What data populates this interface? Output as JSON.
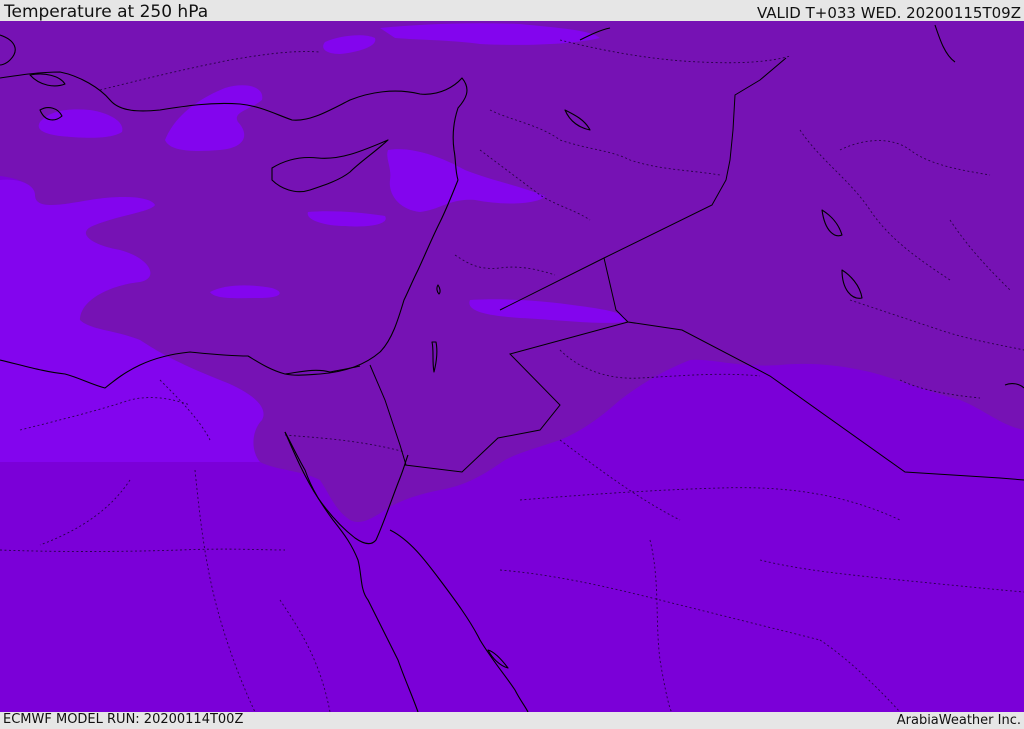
{
  "header": {
    "title": "Temperature at 250 hPa",
    "valid": "VALID T+033 WED. 20200115T09Z"
  },
  "footer": {
    "model_run": "ECMWF MODEL RUN: 20200114T00Z",
    "credit": "ArabiaWeather Inc."
  },
  "colors": {
    "background_field": "#7b00d8",
    "warmer_band": "#7612b4",
    "cold_patch": "#8305ee",
    "frame": "#e6e6e6",
    "coastline": "#000000"
  }
}
